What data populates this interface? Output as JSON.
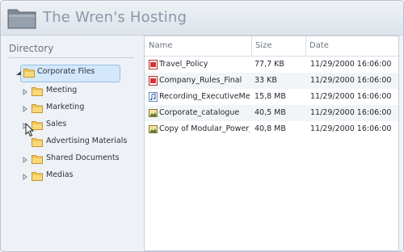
{
  "app": {
    "title": "The Wren's Hosting",
    "accent": "#d4e8fb",
    "title_color": "#8c97a6"
  },
  "directory": {
    "heading": "Directory",
    "items": [
      {
        "label": "Corporate Files",
        "selected": true,
        "expanded": true,
        "level": 0
      },
      {
        "label": "Meeting",
        "level": 1
      },
      {
        "label": "Marketing",
        "level": 1
      },
      {
        "label": "Sales",
        "level": 1
      },
      {
        "label": "Advertising Materials",
        "level": 1
      },
      {
        "label": "Shared Documents",
        "level": 1
      },
      {
        "label": "Medias",
        "level": 1
      }
    ]
  },
  "files": {
    "columns": {
      "name": "Name",
      "size": "Size",
      "date": "Date"
    },
    "rows": [
      {
        "name": "Travel_Policy",
        "size": "77,7 KB",
        "date": "11/29/2000 16:06:00",
        "icon": "pdf-icon"
      },
      {
        "name": "Company_Rules_Final",
        "size": "33 KB",
        "date": "11/29/2000 16:06:00",
        "icon": "pdf-icon"
      },
      {
        "name": "Recording_ExecutiveMeet",
        "size": "15,8 MB",
        "date": "11/29/2000 16:06:00",
        "icon": "audio-file-icon"
      },
      {
        "name": "Corporate_catalogue",
        "size": "40,5 MB",
        "date": "11/29/2000 16:06:00",
        "icon": "image-file-icon"
      },
      {
        "name": "Copy of Modular_Power_I",
        "size": "40,8 MB",
        "date": "11/29/2000 16:06:00",
        "icon": "image-file-icon"
      }
    ]
  }
}
